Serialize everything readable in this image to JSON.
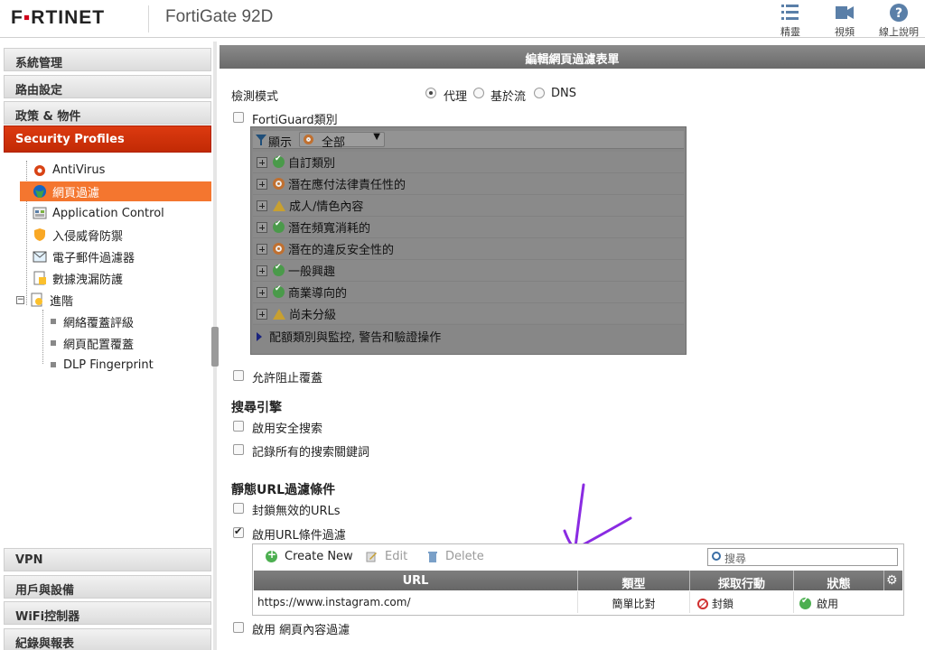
{
  "header": {
    "logo": "F",
    "logo_rest": "RTINET",
    "product": "FortiGate 92D",
    "buttons": [
      {
        "label": "精靈",
        "icon": "wizard-icon"
      },
      {
        "label": "視頻",
        "icon": "video-icon"
      },
      {
        "label": "線上說明",
        "icon": "help-icon"
      }
    ]
  },
  "nav": {
    "sections_top": [
      "系統管理",
      "路由設定",
      "政策 & 物件"
    ],
    "active_section": "Security Profiles",
    "items": [
      {
        "label": "AntiVirus",
        "icon": "antivirus-icon"
      },
      {
        "label": "網頁過濾",
        "icon": "web-filter-icon",
        "selected": true
      },
      {
        "label": "Application Control",
        "icon": "application-control-icon"
      },
      {
        "label": "入侵威脅防禦",
        "icon": "ips-shield-icon"
      },
      {
        "label": "電子郵件過濾器",
        "icon": "email-filter-icon"
      },
      {
        "label": "數據洩漏防護",
        "icon": "dlp-icon"
      },
      {
        "label": "進階",
        "icon": "advanced-icon"
      }
    ],
    "subitems": [
      "網絡覆蓋評級",
      "網頁配置覆蓋",
      "DLP Fingerprint"
    ],
    "sections_bottom": [
      "VPN",
      "用戶與設備",
      "WiFi控制器",
      "紀錄與報表"
    ]
  },
  "main": {
    "title": "編輯網頁過濾表單",
    "inspection_mode_label": "檢測模式",
    "modes": [
      "代理",
      "基於流",
      "DNS"
    ],
    "selected_mode": "代理",
    "fortiguard_label": "FortiGuard類別",
    "category_panel": {
      "show_label": "顯示",
      "filter_value": "全部",
      "categories": [
        {
          "label": "自訂類別",
          "status": "allow"
        },
        {
          "label": "潛在應付法律責任性的",
          "status": "monitor"
        },
        {
          "label": "成人/情色內容",
          "status": "warning"
        },
        {
          "label": "潛在頻寬消耗的",
          "status": "allow"
        },
        {
          "label": "潛在的違反安全性的",
          "status": "monitor"
        },
        {
          "label": "一般興趣",
          "status": "allow"
        },
        {
          "label": "商業導向的",
          "status": "allow"
        },
        {
          "label": "尚未分級",
          "status": "warning"
        }
      ],
      "footer": "配額類別與監控, 警告和驗證操作"
    },
    "allow_override_label": "允許阻止覆蓋",
    "search_engine": {
      "heading": "搜尋引擎",
      "safe_search": "啟用安全搜索",
      "log_keywords": "記錄所有的搜索關鍵詞"
    },
    "static_url": {
      "heading": "靜態URL過濾條件",
      "block_invalid": "封鎖無效的URLs",
      "enable_url_filter": "啟用URL條件過濾"
    },
    "url_table": {
      "create_new": "Create New",
      "edit": "Edit",
      "delete": "Delete",
      "search_placeholder": "搜尋",
      "columns": [
        "URL",
        "類型",
        "採取行動",
        "狀態"
      ],
      "rows": [
        {
          "url": "https://www.instagram.com/",
          "type": "簡單比對",
          "action": "封鎖",
          "status": "啟用"
        }
      ]
    },
    "content_filter_label": "啟用 網頁內容過濾"
  },
  "colors": {
    "accent": "#c22a05",
    "selected_item": "#f4762f",
    "annotation_arrow": "#8a2be2"
  }
}
